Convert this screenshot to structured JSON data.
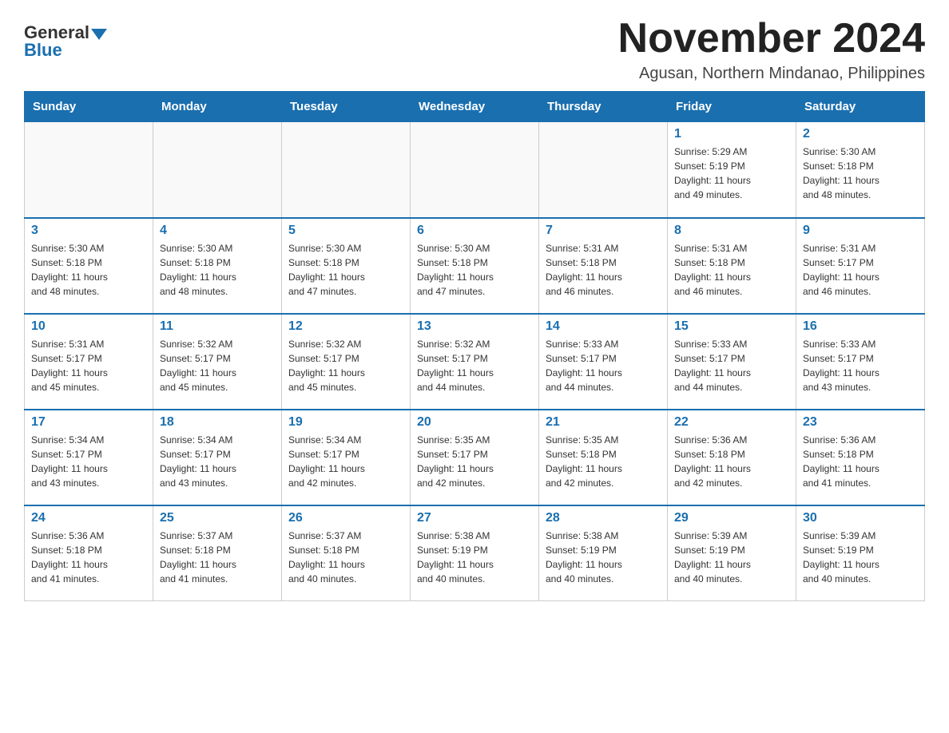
{
  "logo": {
    "general": "General",
    "blue": "Blue"
  },
  "title": "November 2024",
  "location": "Agusan, Northern Mindanao, Philippines",
  "weekdays": [
    "Sunday",
    "Monday",
    "Tuesday",
    "Wednesday",
    "Thursday",
    "Friday",
    "Saturday"
  ],
  "weeks": [
    [
      {
        "day": "",
        "info": ""
      },
      {
        "day": "",
        "info": ""
      },
      {
        "day": "",
        "info": ""
      },
      {
        "day": "",
        "info": ""
      },
      {
        "day": "",
        "info": ""
      },
      {
        "day": "1",
        "info": "Sunrise: 5:29 AM\nSunset: 5:19 PM\nDaylight: 11 hours\nand 49 minutes."
      },
      {
        "day": "2",
        "info": "Sunrise: 5:30 AM\nSunset: 5:18 PM\nDaylight: 11 hours\nand 48 minutes."
      }
    ],
    [
      {
        "day": "3",
        "info": "Sunrise: 5:30 AM\nSunset: 5:18 PM\nDaylight: 11 hours\nand 48 minutes."
      },
      {
        "day": "4",
        "info": "Sunrise: 5:30 AM\nSunset: 5:18 PM\nDaylight: 11 hours\nand 48 minutes."
      },
      {
        "day": "5",
        "info": "Sunrise: 5:30 AM\nSunset: 5:18 PM\nDaylight: 11 hours\nand 47 minutes."
      },
      {
        "day": "6",
        "info": "Sunrise: 5:30 AM\nSunset: 5:18 PM\nDaylight: 11 hours\nand 47 minutes."
      },
      {
        "day": "7",
        "info": "Sunrise: 5:31 AM\nSunset: 5:18 PM\nDaylight: 11 hours\nand 46 minutes."
      },
      {
        "day": "8",
        "info": "Sunrise: 5:31 AM\nSunset: 5:18 PM\nDaylight: 11 hours\nand 46 minutes."
      },
      {
        "day": "9",
        "info": "Sunrise: 5:31 AM\nSunset: 5:17 PM\nDaylight: 11 hours\nand 46 minutes."
      }
    ],
    [
      {
        "day": "10",
        "info": "Sunrise: 5:31 AM\nSunset: 5:17 PM\nDaylight: 11 hours\nand 45 minutes."
      },
      {
        "day": "11",
        "info": "Sunrise: 5:32 AM\nSunset: 5:17 PM\nDaylight: 11 hours\nand 45 minutes."
      },
      {
        "day": "12",
        "info": "Sunrise: 5:32 AM\nSunset: 5:17 PM\nDaylight: 11 hours\nand 45 minutes."
      },
      {
        "day": "13",
        "info": "Sunrise: 5:32 AM\nSunset: 5:17 PM\nDaylight: 11 hours\nand 44 minutes."
      },
      {
        "day": "14",
        "info": "Sunrise: 5:33 AM\nSunset: 5:17 PM\nDaylight: 11 hours\nand 44 minutes."
      },
      {
        "day": "15",
        "info": "Sunrise: 5:33 AM\nSunset: 5:17 PM\nDaylight: 11 hours\nand 44 minutes."
      },
      {
        "day": "16",
        "info": "Sunrise: 5:33 AM\nSunset: 5:17 PM\nDaylight: 11 hours\nand 43 minutes."
      }
    ],
    [
      {
        "day": "17",
        "info": "Sunrise: 5:34 AM\nSunset: 5:17 PM\nDaylight: 11 hours\nand 43 minutes."
      },
      {
        "day": "18",
        "info": "Sunrise: 5:34 AM\nSunset: 5:17 PM\nDaylight: 11 hours\nand 43 minutes."
      },
      {
        "day": "19",
        "info": "Sunrise: 5:34 AM\nSunset: 5:17 PM\nDaylight: 11 hours\nand 42 minutes."
      },
      {
        "day": "20",
        "info": "Sunrise: 5:35 AM\nSunset: 5:17 PM\nDaylight: 11 hours\nand 42 minutes."
      },
      {
        "day": "21",
        "info": "Sunrise: 5:35 AM\nSunset: 5:18 PM\nDaylight: 11 hours\nand 42 minutes."
      },
      {
        "day": "22",
        "info": "Sunrise: 5:36 AM\nSunset: 5:18 PM\nDaylight: 11 hours\nand 42 minutes."
      },
      {
        "day": "23",
        "info": "Sunrise: 5:36 AM\nSunset: 5:18 PM\nDaylight: 11 hours\nand 41 minutes."
      }
    ],
    [
      {
        "day": "24",
        "info": "Sunrise: 5:36 AM\nSunset: 5:18 PM\nDaylight: 11 hours\nand 41 minutes."
      },
      {
        "day": "25",
        "info": "Sunrise: 5:37 AM\nSunset: 5:18 PM\nDaylight: 11 hours\nand 41 minutes."
      },
      {
        "day": "26",
        "info": "Sunrise: 5:37 AM\nSunset: 5:18 PM\nDaylight: 11 hours\nand 40 minutes."
      },
      {
        "day": "27",
        "info": "Sunrise: 5:38 AM\nSunset: 5:19 PM\nDaylight: 11 hours\nand 40 minutes."
      },
      {
        "day": "28",
        "info": "Sunrise: 5:38 AM\nSunset: 5:19 PM\nDaylight: 11 hours\nand 40 minutes."
      },
      {
        "day": "29",
        "info": "Sunrise: 5:39 AM\nSunset: 5:19 PM\nDaylight: 11 hours\nand 40 minutes."
      },
      {
        "day": "30",
        "info": "Sunrise: 5:39 AM\nSunset: 5:19 PM\nDaylight: 11 hours\nand 40 minutes."
      }
    ]
  ]
}
